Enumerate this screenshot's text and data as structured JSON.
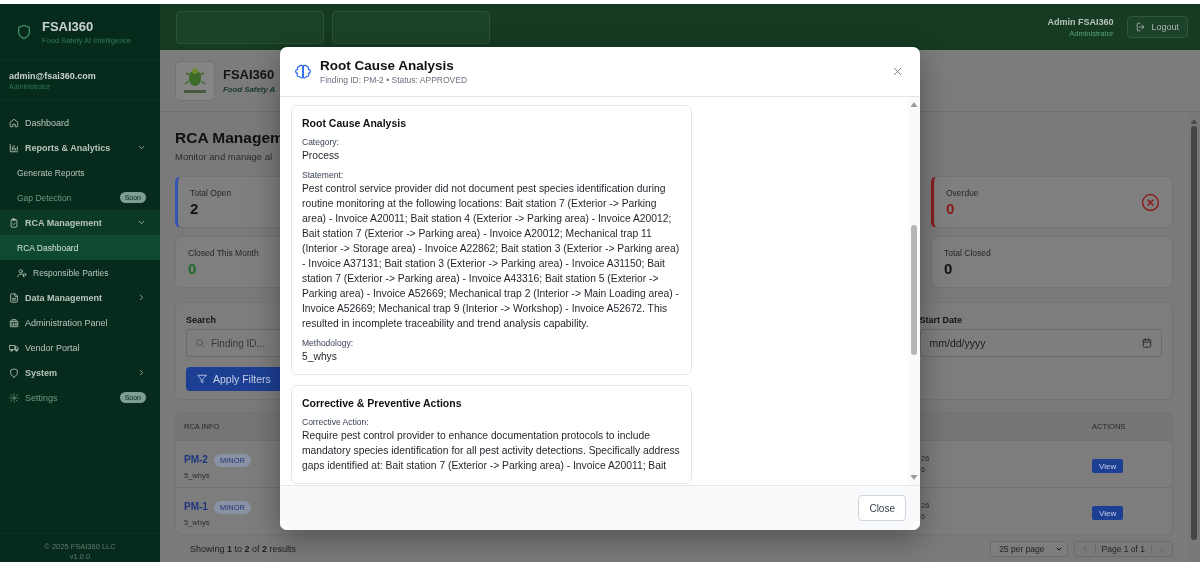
{
  "sidebar": {
    "brand": {
      "title": "FSAI360",
      "tagline": "Food Safety AI Intelligence"
    },
    "user": {
      "email": "admin@fsai360.com",
      "role": "Administrator"
    },
    "nav": [
      {
        "label": "Dashboard",
        "kind": "link",
        "selected": false,
        "disabled": false
      },
      {
        "label": "Reports & Analytics",
        "kind": "group",
        "expanded": true,
        "selected": false,
        "disabled": false,
        "children": [
          {
            "label": "Generate Reports",
            "selected": false,
            "disabled": false
          },
          {
            "label": "Gap Detection",
            "selected": false,
            "disabled": true,
            "badge": "Soon"
          }
        ]
      },
      {
        "label": "RCA Management",
        "kind": "group",
        "expanded": true,
        "selected": true,
        "disabled": false,
        "children": [
          {
            "label": "RCA Dashboard",
            "selected": true,
            "disabled": false
          },
          {
            "label": "Responsible Parties",
            "selected": false,
            "disabled": false
          }
        ]
      },
      {
        "label": "Data Management",
        "kind": "group",
        "expanded": false,
        "selected": false,
        "disabled": false
      },
      {
        "label": "Administration Panel",
        "kind": "link",
        "selected": false,
        "disabled": false
      },
      {
        "label": "Vendor Portal",
        "kind": "link",
        "selected": false,
        "disabled": false
      },
      {
        "label": "System",
        "kind": "group",
        "expanded": false,
        "selected": false,
        "disabled": false
      },
      {
        "label": "Settings",
        "kind": "link",
        "selected": false,
        "disabled": true,
        "badge": "Soon"
      }
    ],
    "footer": {
      "copyright": "© 2025 FSAI360 LLC",
      "version": "v1.0.0"
    }
  },
  "header": {
    "user_name": "Admin FSAI360",
    "user_role": "Administrator",
    "logout": "Logout"
  },
  "brand_bar": {
    "title": "FSAI360",
    "tagline": "Food Safety A"
  },
  "page": {
    "title": "RCA Managem",
    "subtitle": "Monitor and manage al"
  },
  "stats": [
    {
      "label": "Total Open",
      "value": "2",
      "kind": "open"
    },
    {
      "label": "Overdue",
      "value": "0",
      "kind": "overdue"
    },
    {
      "label": "Closed This Month",
      "value": "0",
      "kind": "closed_month"
    },
    {
      "label": "Total Closed",
      "value": "0",
      "kind": "closed"
    }
  ],
  "filters": {
    "search_label": "Search",
    "search_placeholder": "Finding ID...",
    "start_date_label": "Start Date",
    "start_date_placeholder": "mm/dd/yyyy",
    "apply": "Apply Filters"
  },
  "table": {
    "columns": [
      "RCA INFO",
      "ACTIONS"
    ],
    "rows": [
      {
        "id": "PM-2",
        "severity": "MINOR",
        "method": "5_whys",
        "column_3": [
          "26",
          "6"
        ],
        "action": "View"
      },
      {
        "id": "PM-1",
        "severity": "MINOR",
        "method": "5_whys",
        "column_3": [
          "26",
          "6"
        ],
        "action": "View"
      }
    ]
  },
  "pagination": {
    "summary": "Showing **1** to **2** of **2** results",
    "per_page": "25 per page",
    "page": "Page 1 of 1"
  },
  "modal": {
    "title": "Root Cause Analysis",
    "subtitle": "Finding ID: PM-2 • Status: APPROVED",
    "sections": [
      {
        "title": "Root Cause Analysis",
        "fields": [
          {
            "label": "Category:",
            "value": "Process"
          },
          {
            "label": "Statement:",
            "value": "Pest control service provider did not document pest species identification during routine monitoring at the following locations: Bait station 7 (Exterior -> Parking area) - Invoice A20011; Bait station 4 (Exterior -> Parking area) - Invoice A20012; Bait station 7 (Exterior -> Parking area) - Invoice A20012; Mechanical trap 11 (Interior -> Storage area) - Invoice A22862; Bait station 3 (Exterior -> Parking area) - Invoice A37131; Bait station 3 (Exterior -> Parking area) - Invoice A31150; Bait station 7 (Exterior -> Parking area) - Invoice A43316; Bait station 5 (Exterior -> Parking area) - Invoice A52669; Mechanical trap 2 (Interior -> Main Loading area) - Invoice A52669; Mechanical trap 9 (Interior -> Workshop) - Invoice A52672. This resulted in incomplete traceability and trend analysis capability."
          },
          {
            "label": "Methodology:",
            "value": "5_whys"
          }
        ]
      },
      {
        "title": "Corrective & Preventive Actions",
        "fields": [
          {
            "label": "Corrective Action:",
            "value": "Require pest control provider to enhance documentation protocols to include mandatory species identification for all pest activity detections. Specifically address gaps identified at: Bait station 7 (Exterior -> Parking area) - Invoice A20011; Bait"
          }
        ]
      }
    ],
    "close": "Close"
  }
}
